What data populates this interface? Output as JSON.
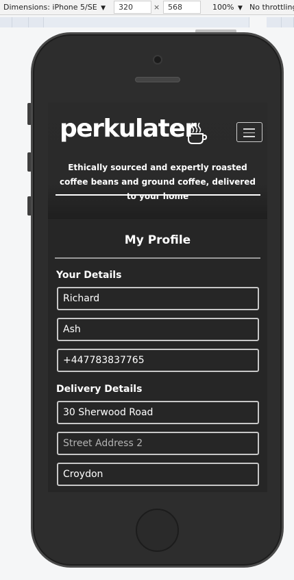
{
  "devtools": {
    "dimensions_label": "Dimensions: iPhone 5/SE",
    "width_value": "320",
    "times": "×",
    "height_value": "568",
    "zoom": "100%",
    "throttling": "No throttling"
  },
  "site": {
    "logo": "perkulater",
    "tagline": "Ethically sourced and expertly roasted coffee beans and ground coffee, delivered to your home"
  },
  "profile": {
    "title": "My Profile",
    "your_details_label": "Your Details",
    "first_name": "Richard",
    "last_name": "Ash",
    "phone": "+447783837765",
    "delivery_details_label": "Delivery Details",
    "street_address_1": "30 Sherwood Road",
    "street_address_2_placeholder": "Street Address 2",
    "town": "Croydon"
  }
}
